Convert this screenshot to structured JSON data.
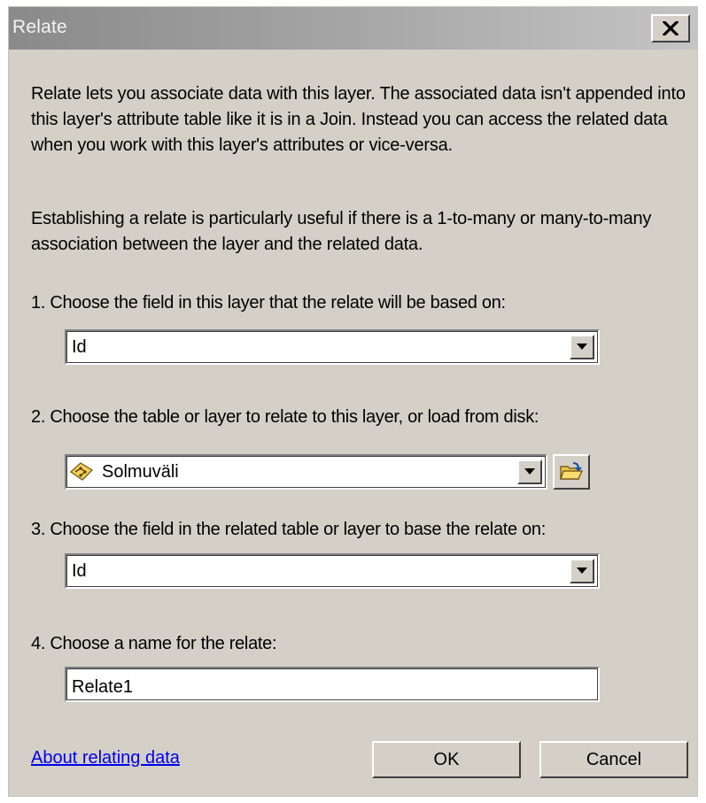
{
  "window": {
    "title": "Relate"
  },
  "description": {
    "para1": "Relate lets you associate data with this layer. The associated data isn't appended into this layer's attribute table like it is in a Join. Instead you can access the related data when you work with this layer's attributes or vice-versa.",
    "para2": "Establishing a relate is particularly useful if there is a 1-to-many or many-to-many association between the layer and the related data."
  },
  "step1": {
    "label": "1. Choose the field in this layer that the relate will be based on:",
    "value": "Id"
  },
  "step2": {
    "label": "2. Choose the table or layer to relate to this layer, or load from disk:",
    "value": "Solmuväli",
    "icon": "layer-icon"
  },
  "step3": {
    "label": "3. Choose the field in the related table or layer to base the relate on:",
    "value": "Id"
  },
  "step4": {
    "label": "4. Choose a name for the relate:",
    "value": "Relate1"
  },
  "footer": {
    "link_text": "About relating data",
    "ok_label": "OK",
    "cancel_label": "Cancel"
  }
}
